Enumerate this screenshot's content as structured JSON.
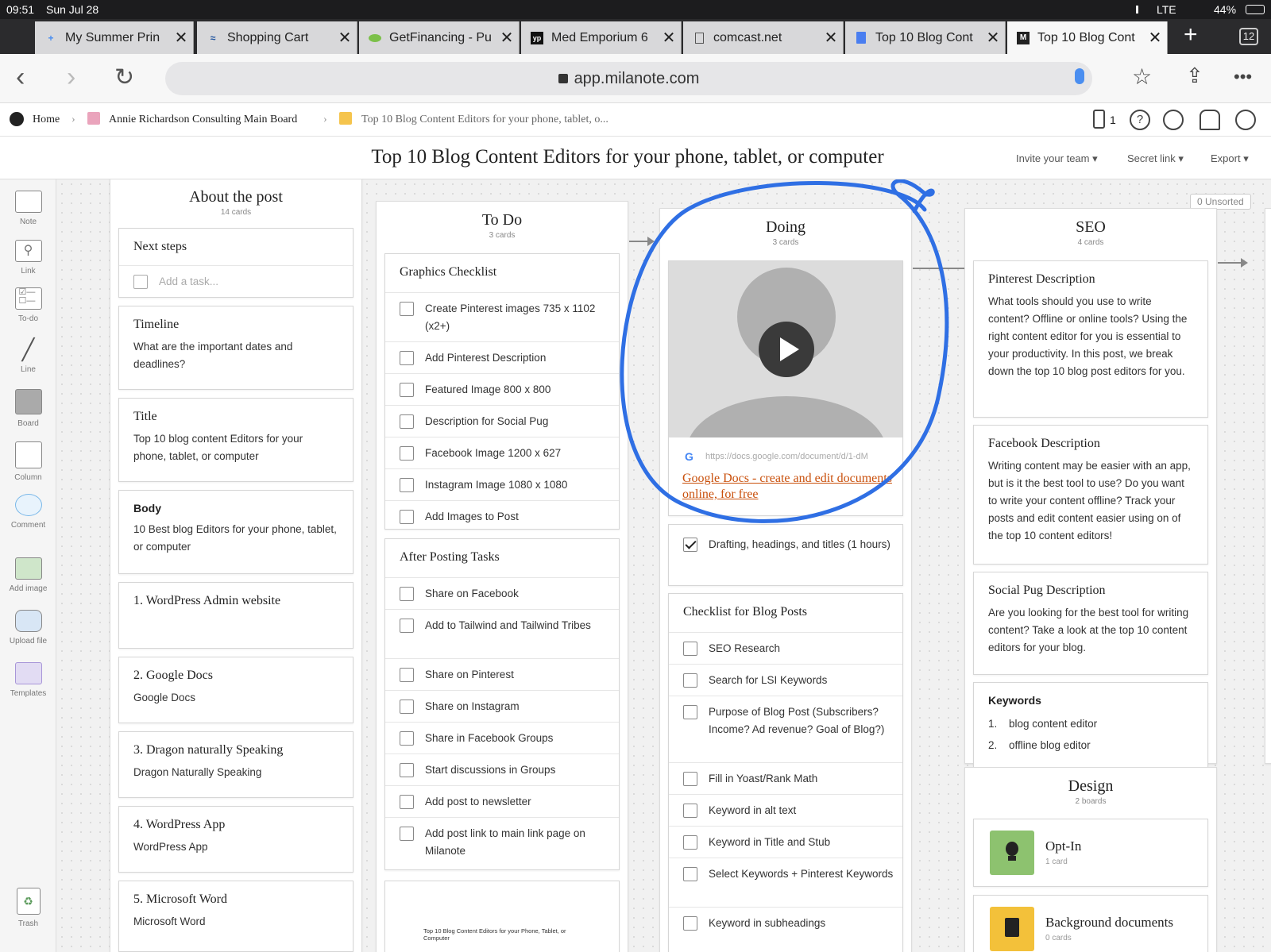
{
  "status": {
    "time": "09:51",
    "date": "Sun Jul 28",
    "network": "LTE",
    "battery": "44%"
  },
  "tabs": [
    {
      "label": "My Summer Prin",
      "icon": "planner-icon"
    },
    {
      "label": "Shopping Cart",
      "icon": "shopping-icon"
    },
    {
      "label": "GetFinancing - Pu",
      "icon": "finance-icon"
    },
    {
      "label": "Med Emporium 6",
      "icon": "yp-icon"
    },
    {
      "label": "comcast.net",
      "icon": "page-icon"
    },
    {
      "label": "Top 10 Blog Cont",
      "icon": "docs-icon"
    },
    {
      "label": "Top 10 Blog Cont",
      "icon": "milanote-icon",
      "active": true
    }
  ],
  "tab_count": "12",
  "url": "app.milanote.com",
  "breadcrumb": {
    "home": "Home",
    "parent": "Annie Richardson Consulting Main Board",
    "current": "Top 10 Blog Content Editors for your phone, tablet, o...",
    "device_count": "1"
  },
  "board": {
    "title": "Top 10 Blog Content Editors for your phone, tablet, or computer",
    "invite": "Invite your team",
    "secret_link": "Secret link",
    "export": "Export",
    "unsorted": "0 Unsorted"
  },
  "tools": [
    "Note",
    "Link",
    "To-do",
    "Line",
    "Board",
    "Column",
    "Comment",
    "Add image",
    "Upload file",
    "Templates",
    "Trash"
  ],
  "about": {
    "title": "About the post",
    "count": "14 cards",
    "next_steps": "Next steps",
    "add_task": "Add a task...",
    "cards": [
      {
        "title": "Timeline",
        "body": "What are the important dates and deadlines?"
      },
      {
        "title": "Title",
        "body": "Top 10 blog content Editors for your phone, tablet, or computer"
      },
      {
        "title": "Body",
        "body": "10 Best  blog Editors for your phone, tablet, or computer"
      },
      {
        "title": "1. WordPress Admin website",
        "body": ""
      },
      {
        "title": "2. Google Docs",
        "body": "Google Docs"
      },
      {
        "title": "3. Dragon naturally Speaking",
        "body": "Dragon Naturally Speaking"
      },
      {
        "title": "4. WordPress App",
        "body": "WordPress App"
      },
      {
        "title": "5. Microsoft Word",
        "body": "Microsoft Word"
      }
    ]
  },
  "todo": {
    "title": "To Do",
    "count": "3 cards",
    "graphics_title": "Graphics Checklist",
    "graphics": [
      "Create Pinterest images 735 x 1102 (x2+)",
      "Add Pinterest Description",
      "Featured Image 800 x 800",
      "Description for Social Pug",
      "Facebook Image 1200 x 627",
      "Instagram Image 1080 x 1080",
      "Add Images to Post"
    ],
    "after_title": "After Posting Tasks",
    "after": [
      "Share on Facebook",
      "Add to Tailwind and Tailwind Tribes",
      "Share on Pinterest",
      "Share on Instagram",
      "Share in Facebook Groups",
      "Start discussions in Groups",
      "Add post to newsletter",
      "Add post link to main link page on Milanote"
    ],
    "thumb_caption": "Top 10 Blog Content Editors for your Phone, Tablet, or Computer"
  },
  "doing": {
    "title": "Doing",
    "count": "3 cards",
    "link_url": "https://docs.google.com/document/d/1-dM",
    "link_title": "Google Docs - create and edit documents online, for free",
    "drafting": "Drafting, headings, and titles (1 hours)",
    "checklist_title": "Checklist for Blog Posts",
    "checklist": [
      "SEO Research",
      "Search for LSI Keywords",
      "Purpose of Blog Post (Subscribers? Income? Ad revenue? Goal of Blog?)",
      "Fill in Yoast/Rank Math",
      "Keyword in alt text",
      "Keyword in Title and Stub",
      "Select Keywords + Pinterest Keywords",
      "Keyword in subheadings"
    ],
    "annotation_color": "#2f6fe4"
  },
  "seo": {
    "title": "SEO",
    "count": "4 cards",
    "cards": [
      {
        "title": "Pinterest Description",
        "body": "What tools should you use to write content? Offline or online tools? Using the right content editor for you is essential to your productivity. In this post, we break down the top 10 blog post editors for you."
      },
      {
        "title": "Facebook Description",
        "body": "Writing content may be easier with an app, but is it the best tool to use? Do you want to write your content offline? Track your posts and edit content easier using on of the top 10 content editors!"
      },
      {
        "title": "Social Pug Description",
        "body": "Are you looking for the best tool for writing content? Take a look at the top 10 content editors for your blog."
      }
    ],
    "keywords_title": "Keywords",
    "keywords": [
      "1.",
      "blog content editor",
      "2.",
      "offline blog editor"
    ]
  },
  "design": {
    "title": "Design",
    "count": "2 boards",
    "boards": [
      {
        "title": "Opt-In",
        "count": "1 card",
        "color": "#8dc26f",
        "icon": "lightbulb-icon"
      },
      {
        "title": "Background documents",
        "count": "0 cards",
        "color": "#f3c13a",
        "icon": "document-icon"
      }
    ]
  }
}
